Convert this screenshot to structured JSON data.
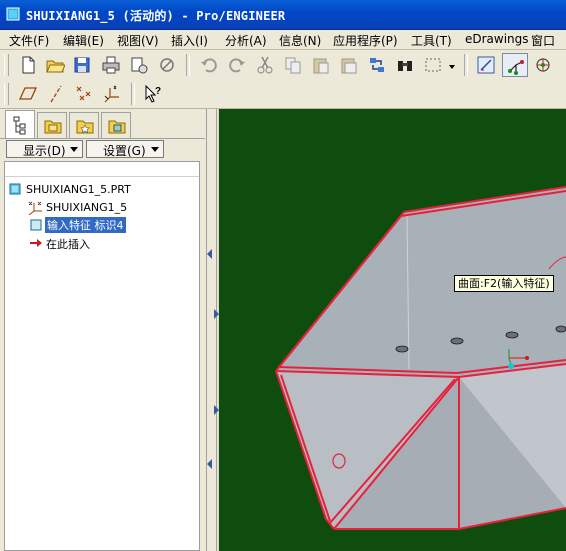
{
  "window": {
    "title": "SHUIXIANG1_5 (活动的) - Pro/ENGINEER",
    "icon": "pro-engineer-icon"
  },
  "menu": {
    "items": [
      {
        "label": "文件(F)"
      },
      {
        "label": "编辑(E)"
      },
      {
        "label": "视图(V)"
      },
      {
        "label": "插入(I)"
      },
      {
        "label": "分析(A)"
      },
      {
        "label": "信息(N)"
      },
      {
        "label": "应用程序(P)"
      },
      {
        "label": "工具(T)"
      },
      {
        "label": "eDrawings"
      },
      {
        "label": "窗口"
      }
    ]
  },
  "toolbar1": {
    "buttons": [
      "new-file-icon",
      "open-folder-icon",
      "save-icon",
      "print-icon",
      "save-copy-icon",
      "erase-icon",
      "undo-icon",
      "redo-icon",
      "cut-icon",
      "copy-icon",
      "paste-icon",
      "paste-special-icon",
      "regenerate-icon",
      "find-binoculars-icon",
      "selection-box-icon",
      "datum-display-icon",
      "datum-axis-icon",
      "spin-center-icon"
    ]
  },
  "toolbar2": {
    "buttons": [
      "datum-plane-icon",
      "datum-axis-icon",
      "datum-point-icon",
      "coordinate-system-icon",
      "context-help-icon"
    ]
  },
  "panel": {
    "tabs": [
      "model-tree-icon",
      "folder-browser-icon",
      "favorites-icon",
      "connections-icon"
    ],
    "show_button": "显示(D)",
    "settings_button": "设置(G)",
    "tree": {
      "root": "SHUIXIANG1_5.PRT",
      "items": [
        {
          "label": "SHUIXIANG1_5",
          "icon": "csys-icon",
          "selected": false
        },
        {
          "label": "输入特征 标识4",
          "icon": "import-feature-icon",
          "selected": true
        },
        {
          "label": "在此插入",
          "icon": "insert-here-arrow-icon",
          "selected": false
        }
      ]
    }
  },
  "viewport": {
    "tooltip": "曲面:F2(输入特征)",
    "background_color": "#0e4d0e",
    "edge_color": "#e8203c",
    "surface_color": "#b4bac2"
  }
}
